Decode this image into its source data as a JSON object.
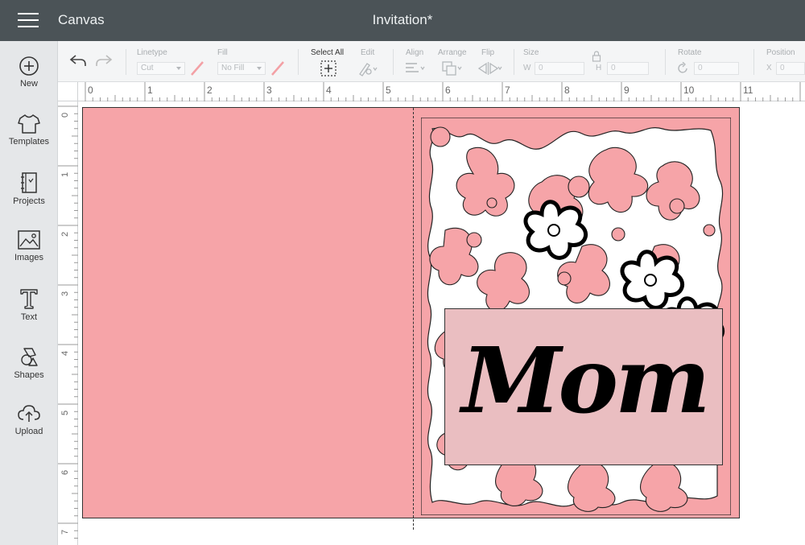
{
  "header": {
    "app_title": "Canvas",
    "doc_title": "Invitation*"
  },
  "sidebar": {
    "items": [
      {
        "label": "New",
        "icon": "plus-circle-icon"
      },
      {
        "label": "Templates",
        "icon": "tshirt-icon"
      },
      {
        "label": "Projects",
        "icon": "notebook-icon"
      },
      {
        "label": "Images",
        "icon": "image-icon"
      },
      {
        "label": "Text",
        "icon": "text-t-icon"
      },
      {
        "label": "Shapes",
        "icon": "shapes-icon"
      },
      {
        "label": "Upload",
        "icon": "cloud-upload-icon"
      }
    ]
  },
  "toolbar": {
    "linetype": {
      "label": "Linetype",
      "value": "Cut"
    },
    "fill": {
      "label": "Fill",
      "value": "No Fill"
    },
    "select_all": {
      "label": "Select All"
    },
    "edit": {
      "label": "Edit"
    },
    "align": {
      "label": "Align"
    },
    "arrange": {
      "label": "Arrange"
    },
    "flip": {
      "label": "Flip"
    },
    "size": {
      "label": "Size",
      "w_label": "W",
      "w_value": "0",
      "h_label": "H",
      "h_value": "0"
    },
    "rotate": {
      "label": "Rotate",
      "value": "0"
    },
    "position": {
      "label": "Position",
      "x_label": "X",
      "x_value": "0"
    }
  },
  "ruler": {
    "top_numbers": [
      "0",
      "1",
      "2",
      "3",
      "4",
      "5",
      "6",
      "7",
      "8",
      "9",
      "10",
      "11"
    ],
    "left_numbers": [
      "0",
      "1",
      "2",
      "3",
      "4",
      "5",
      "6",
      "7"
    ]
  },
  "canvas": {
    "card_text": "Mom",
    "card_color": "#f6a4a8",
    "label_color": "#eabec1"
  }
}
